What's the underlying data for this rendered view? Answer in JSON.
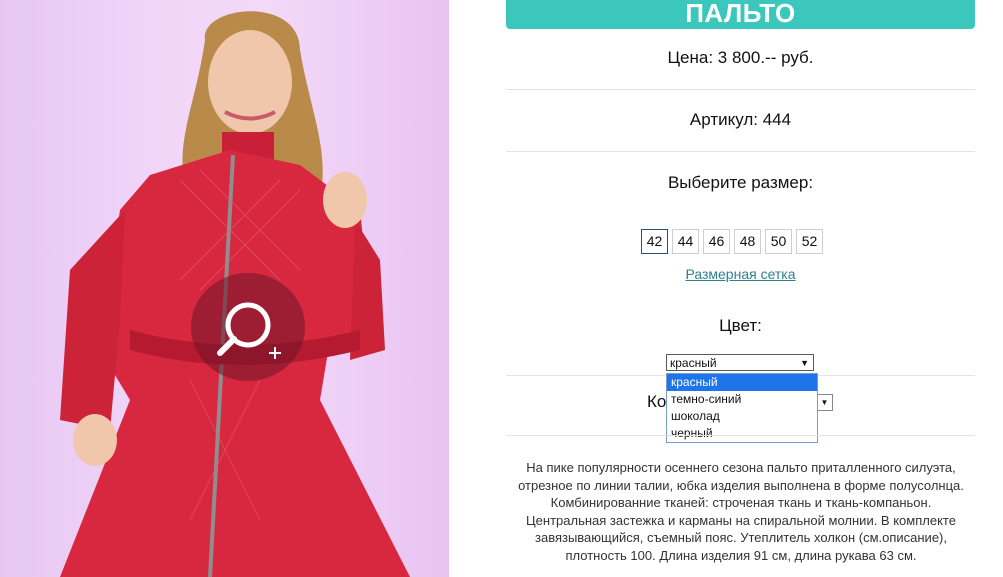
{
  "product": {
    "title": "ПАЛЬТО",
    "price": "Цена: 3 800.-- руб.",
    "article": "Артикул: 444",
    "size_prompt": "Выберите размер:",
    "sizes": [
      "42",
      "44",
      "46",
      "48",
      "50",
      "52"
    ],
    "selected_size": "42",
    "size_chart_link": "Размерная сетка",
    "color_label": "Цвет:",
    "color_selected": "красный",
    "color_options": [
      "красный",
      "темно-синий",
      "шоколад",
      "черный"
    ],
    "quantity_label_partial": "Ко",
    "description": "На пике популярности осеннего сезона пальто приталленного силуэта, отрезное по линии талии, юбка изделия выполнена в форме полусолнца. Комбинированние тканей: строченая ткань и ткань-компаньон. Центральная застежка и карманы на спиральной молнии. В комплекте завязывающийся, съемный пояс. Утеплитель холкон (см.описание), плотность 100. Длина изделия 91 см, длина рукава 63 см."
  },
  "colors": {
    "accent": "#3cc7bd",
    "coat": "#d8283f",
    "selected_option": "#1e74e8"
  }
}
